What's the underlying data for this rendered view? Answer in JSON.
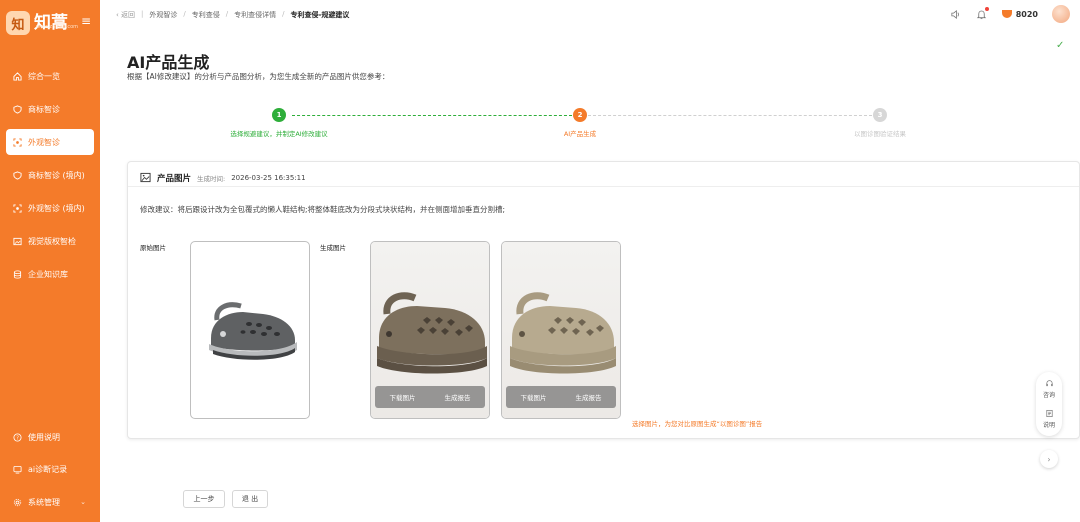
{
  "app": {
    "logo_text": "知蒿",
    "logo_sub": "www.zhihao.com",
    "logo_mark": "知"
  },
  "sidebar": {
    "items": [
      {
        "label": "综合一览",
        "icon": "home-icon"
      },
      {
        "label": "商标智诊",
        "icon": "shield-icon"
      },
      {
        "label": "外观智诊",
        "icon": "scan-icon"
      },
      {
        "label": "商标智诊 (境内)",
        "icon": "shield-icon"
      },
      {
        "label": "外观智诊 (境内)",
        "icon": "scan-icon"
      },
      {
        "label": "视觉版权智检",
        "icon": "image-icon"
      },
      {
        "label": "企业知识库",
        "icon": "database-icon"
      },
      {
        "label": "使用说明",
        "icon": "help-icon"
      },
      {
        "label": "ai诊断记录",
        "icon": "record-icon"
      },
      {
        "label": "系统管理",
        "icon": "gear-icon"
      }
    ],
    "active_index": 2
  },
  "header": {
    "back": "返回",
    "breadcrumb": [
      "外观智诊",
      "专利查侵",
      "专利查侵详情",
      "专利查侵-规避建议"
    ],
    "points": "8020"
  },
  "main": {
    "title": "AI产品生成",
    "description": "根据【AI修改建议】的分析与产品图分析，为您生成全新的产品图片供您参考：",
    "steps": [
      {
        "num": "1",
        "label": "选择规避建议，并制定AI修改建议",
        "status": "done"
      },
      {
        "num": "2",
        "label": "AI产品生成",
        "status": "active"
      },
      {
        "num": "3",
        "label": "以图诊图验证结果",
        "status": "pending"
      }
    ]
  },
  "card": {
    "title": "产品图片",
    "time_label": "生成时间:",
    "time": "2026-03-25 16:35:11",
    "suggestion": "修改建议：将后跟设计改为全包覆式的懒人鞋结构;将整体鞋底改为分段式块状结构，并在侧面增加垂直分割槽;",
    "original_label": "原始图片",
    "generated_label": "生成图片",
    "download": "下载图片",
    "report": "生成报告",
    "hint": "选择图片，为您对比原图生成“以图诊图”报告"
  },
  "tools": {
    "tool1": "咨询",
    "tool2": "说明"
  },
  "footer": {
    "prev": "上一步",
    "exit": "退 出"
  },
  "colors": {
    "brand": "#f47b2a",
    "success": "#2eae3a"
  }
}
